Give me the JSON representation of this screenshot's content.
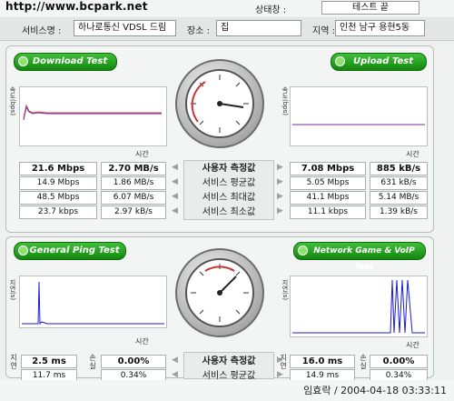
{
  "header": {
    "watermark": "http://www.bcpark.net",
    "status_label": "상태창 :",
    "status_value": "테스트 끝",
    "service_label": "서비스명 :",
    "service_value": "하나로통신 VDSL 드림",
    "place_label": "장소 :",
    "place_value": "집",
    "region_label": "지역 :",
    "region_value": "인천 남구 용현5동"
  },
  "speed": {
    "download_button": "Download Test",
    "upload_button": "Upload Test",
    "y_axis_label": "속도(bps)",
    "x_axis_label": "시간",
    "rows": [
      {
        "label": "사용자 측정값",
        "dl_bps": "21.6 Mbps",
        "dl_bytes": "2.70 MB/s",
        "ul_bps": "7.08 Mbps",
        "ul_bytes": "885 kB/s"
      },
      {
        "label": "서비스 평균값",
        "dl_bps": "14.9 Mbps",
        "dl_bytes": "1.86 MB/s",
        "ul_bps": "5.05 Mbps",
        "ul_bytes": "631 kB/s"
      },
      {
        "label": "서비스 최대값",
        "dl_bps": "48.5 Mbps",
        "dl_bytes": "6.07 MB/s",
        "ul_bps": "41.1 Mbps",
        "ul_bytes": "5.14 MB/s"
      },
      {
        "label": "서비스 최소값",
        "dl_bps": "23.7 kbps",
        "dl_bytes": "2.97 kB/s",
        "ul_bps": "11.1 kbps",
        "ul_bytes": "1.39 kB/s"
      }
    ]
  },
  "ping": {
    "ping_button": "General Ping Test",
    "game_button": "Network Game & VoIP Test",
    "y_axis_label": "지연(s)",
    "x_axis_label": "시간",
    "delay_label": "지연",
    "loss_label": "손실",
    "rows": [
      {
        "label": "사용자 측정값",
        "ping_ms": "2.5 ms",
        "ping_loss": "0.00%",
        "game_ms": "16.0 ms",
        "game_loss": "0.00%"
      },
      {
        "label": "서비스 평균값",
        "ping_ms": "11.7 ms",
        "ping_loss": "0.34%",
        "game_ms": "14.9 ms",
        "game_loss": "0.34%"
      }
    ]
  },
  "footer": {
    "signature": "임효락 / 2004-04-18 03:33:11"
  },
  "colors": {
    "button_green": "#1f9b19",
    "download_line": "#7b2b9b",
    "ping_line": "#1b1bd0"
  }
}
